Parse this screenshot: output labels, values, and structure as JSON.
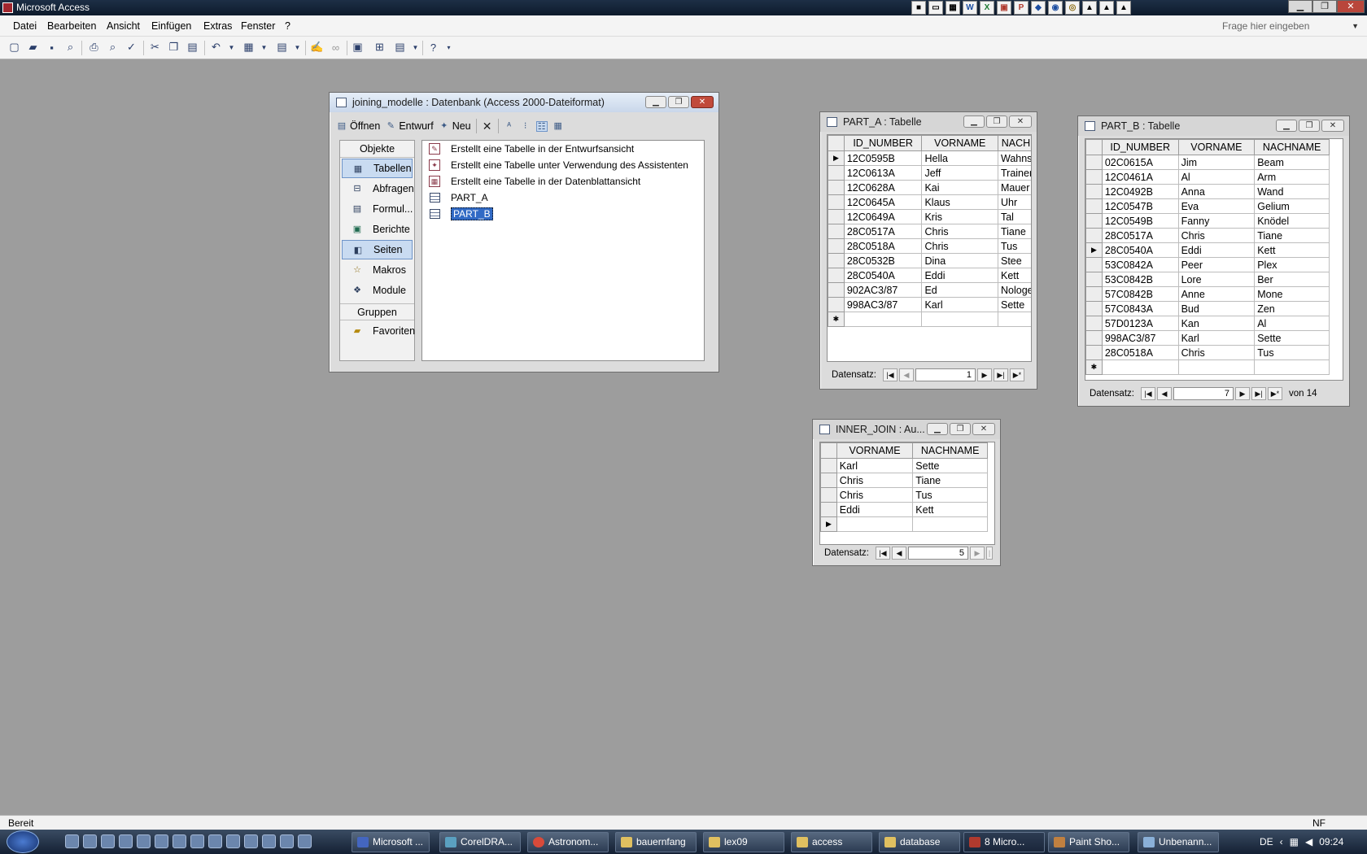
{
  "app": {
    "title": "Microsoft Access"
  },
  "menu": [
    "Datei",
    "Bearbeiten",
    "Ansicht",
    "Einfügen",
    "Extras",
    "Fenster",
    "?"
  ],
  "ask_placeholder": "Frage hier eingeben",
  "db_window": {
    "title": "joining_modelle : Datenbank (Access 2000-Dateiformat)",
    "toolbar": {
      "open": "Öffnen",
      "design": "Entwurf",
      "new": "Neu"
    },
    "objects_header": "Objekte",
    "objects": [
      "Tabellen",
      "Abfragen",
      "Formul...",
      "Berichte",
      "Seiten",
      "Makros",
      "Module"
    ],
    "groups_header": "Gruppen",
    "groups": [
      "Favoriten"
    ],
    "list": [
      "Erstellt eine Tabelle in der Entwurfsansicht",
      "Erstellt eine Tabelle unter Verwendung des Assistenten",
      "Erstellt eine Tabelle in der Datenblattansicht",
      "PART_A",
      "PART_B"
    ]
  },
  "part_a": {
    "title": "PART_A : Tabelle",
    "columns": [
      "ID_NUMBER",
      "VORNAME",
      "NACH"
    ],
    "rows": [
      [
        "12C0595B",
        "Hella",
        "Wahns"
      ],
      [
        "12C0613A",
        "Jeff",
        "Trainer"
      ],
      [
        "12C0628A",
        "Kai",
        "Mauer"
      ],
      [
        "12C0645A",
        "Klaus",
        "Uhr"
      ],
      [
        "12C0649A",
        "Kris",
        "Tal"
      ],
      [
        "28C0517A",
        "Chris",
        "Tiane"
      ],
      [
        "28C0518A",
        "Chris",
        "Tus"
      ],
      [
        "28C0532B",
        "Dina",
        "Stee"
      ],
      [
        "28C0540A",
        "Eddi",
        "Kett"
      ],
      [
        "902AC3/87",
        "Ed",
        "Nologe"
      ],
      [
        "998AC3/87",
        "Karl",
        "Sette"
      ]
    ],
    "nav_label": "Datensatz:",
    "record": "1"
  },
  "part_b": {
    "title": "PART_B : Tabelle",
    "columns": [
      "ID_NUMBER",
      "VORNAME",
      "NACHNAME"
    ],
    "rows": [
      [
        "02C0615A",
        "Jim",
        "Beam"
      ],
      [
        "12C0461A",
        "Al",
        "Arm"
      ],
      [
        "12C0492B",
        "Anna",
        "Wand"
      ],
      [
        "12C0547B",
        "Eva",
        "Gelium"
      ],
      [
        "12C0549B",
        "Fanny",
        "Knödel"
      ],
      [
        "28C0517A",
        "Chris",
        "Tiane"
      ],
      [
        "28C0540A",
        "Eddi",
        "Kett"
      ],
      [
        "53C0842A",
        "Peer",
        "Plex"
      ],
      [
        "53C0842B",
        "Lore",
        "Ber"
      ],
      [
        "57C0842B",
        "Anne",
        "Mone"
      ],
      [
        "57C0843A",
        "Bud",
        "Zen"
      ],
      [
        "57D0123A",
        "Kan",
        "Al"
      ],
      [
        "998AC3/87",
        "Karl",
        "Sette"
      ],
      [
        "28C0518A",
        "Chris",
        "Tus"
      ]
    ],
    "nav_label": "Datensatz:",
    "record": "7",
    "of": "von 14"
  },
  "inner_join": {
    "title": "INNER_JOIN : Au...",
    "columns": [
      "VORNAME",
      "NACHNAME"
    ],
    "rows": [
      [
        "Karl",
        "Sette"
      ],
      [
        "Chris",
        "Tiane"
      ],
      [
        "Chris",
        "Tus"
      ],
      [
        "Eddi",
        "Kett"
      ]
    ],
    "nav_label": "Datensatz:",
    "record": "5"
  },
  "status": {
    "left": "Bereit",
    "right": "NF"
  },
  "taskbar": {
    "tasks": [
      "Microsoft ...",
      "CorelDRA...",
      "Astronom...",
      "bauernfang",
      "lex09",
      "access",
      "database",
      "8 Micro...",
      "Paint Sho...",
      "Unbenann..."
    ],
    "lang": "DE",
    "clock": "09:24"
  }
}
